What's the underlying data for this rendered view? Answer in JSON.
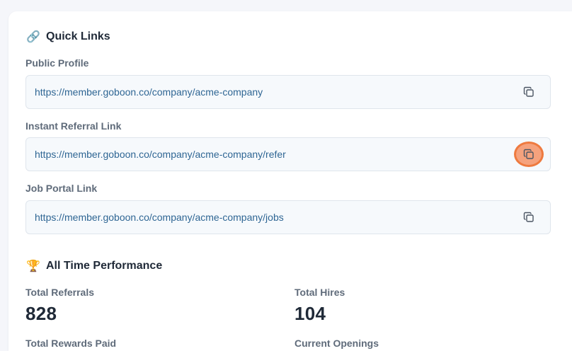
{
  "quick_links": {
    "icon": "link-emoji",
    "title": "Quick Links",
    "items": [
      {
        "label": "Public Profile",
        "url": "https://member.goboon.co/company/acme-company",
        "copy_icon": "copy-icon"
      },
      {
        "label": "Instant Referral Link",
        "url": "https://member.goboon.co/company/acme-company/refer",
        "copy_icon": "copy-icon",
        "highlighted": true
      },
      {
        "label": "Job Portal Link",
        "url": "https://member.goboon.co/company/acme-company/jobs",
        "copy_icon": "copy-icon"
      }
    ]
  },
  "performance": {
    "icon": "trophy-emoji",
    "title": "All Time Performance",
    "stats": [
      {
        "label": "Total Referrals",
        "value": "828"
      },
      {
        "label": "Total Hires",
        "value": "104"
      },
      {
        "label": "Total Rewards Paid",
        "value": ""
      },
      {
        "label": "Current Openings",
        "value": ""
      }
    ]
  },
  "colors": {
    "link_text": "#2f6694",
    "highlight_fill": "#f5a27d",
    "highlight_ring": "#ee7a3f"
  }
}
